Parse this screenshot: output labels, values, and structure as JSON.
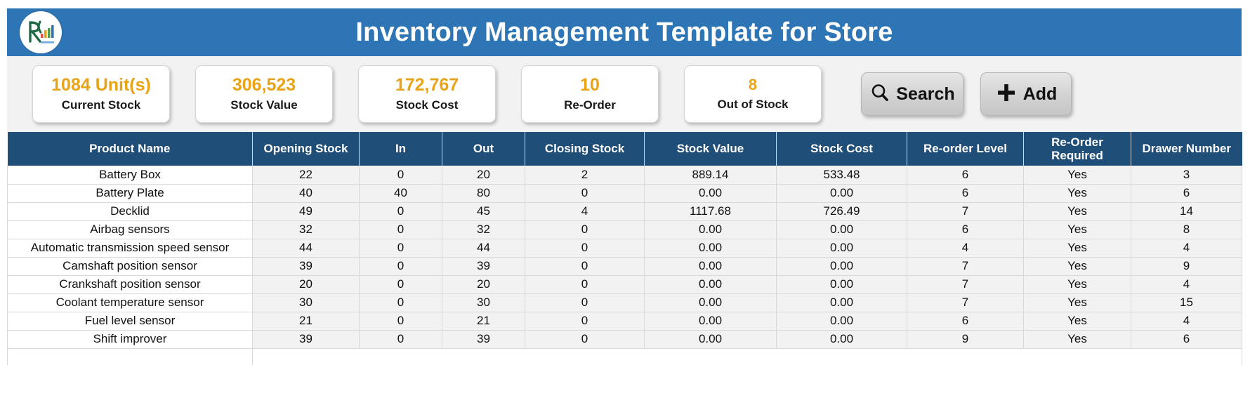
{
  "header": {
    "title": "Inventory Management Template for Store",
    "logo_icon": "company-logo-icon",
    "bar_color": "#2E75B6"
  },
  "kpis": [
    {
      "value": "1084 Unit(s)",
      "label": "Current Stock"
    },
    {
      "value": "306,523",
      "label": "Stock Value"
    },
    {
      "value": "172,767",
      "label": "Stock Cost"
    },
    {
      "value": "10",
      "label": "Re-Order"
    },
    {
      "value": "8",
      "label": "Out of Stock"
    }
  ],
  "kpi_value_color": "#E8A317",
  "actions": {
    "search_label": "Search",
    "search_icon": "search-icon",
    "add_label": "Add",
    "add_icon": "plus-icon"
  },
  "table": {
    "header_color": "#1F4E79",
    "columns": [
      "Product Name",
      "Opening Stock",
      "In",
      "Out",
      "Closing Stock",
      "Stock Value",
      "Stock Cost",
      "Re-order Level",
      "Re-Order Required",
      "Drawer Number"
    ],
    "rows": [
      [
        "Battery Box",
        "22",
        "0",
        "20",
        "2",
        "889.14",
        "533.48",
        "6",
        "Yes",
        "3"
      ],
      [
        "Battery Plate",
        "40",
        "40",
        "80",
        "0",
        "0.00",
        "0.00",
        "6",
        "Yes",
        "6"
      ],
      [
        "Decklid",
        "49",
        "0",
        "45",
        "4",
        "1117.68",
        "726.49",
        "7",
        "Yes",
        "14"
      ],
      [
        "Airbag sensors",
        "32",
        "0",
        "32",
        "0",
        "0.00",
        "0.00",
        "6",
        "Yes",
        "8"
      ],
      [
        "Automatic transmission speed sensor",
        "44",
        "0",
        "44",
        "0",
        "0.00",
        "0.00",
        "4",
        "Yes",
        "4"
      ],
      [
        "Camshaft position sensor",
        "39",
        "0",
        "39",
        "0",
        "0.00",
        "0.00",
        "7",
        "Yes",
        "9"
      ],
      [
        "Crankshaft position sensor",
        "20",
        "0",
        "20",
        "0",
        "0.00",
        "0.00",
        "7",
        "Yes",
        "4"
      ],
      [
        "Coolant temperature sensor",
        "30",
        "0",
        "30",
        "0",
        "0.00",
        "0.00",
        "7",
        "Yes",
        "15"
      ],
      [
        "Fuel level sensor",
        "21",
        "0",
        "21",
        "0",
        "0.00",
        "0.00",
        "6",
        "Yes",
        "4"
      ],
      [
        "Shift improver",
        "39",
        "0",
        "39",
        "0",
        "0.00",
        "0.00",
        "9",
        "Yes",
        "6"
      ]
    ]
  }
}
